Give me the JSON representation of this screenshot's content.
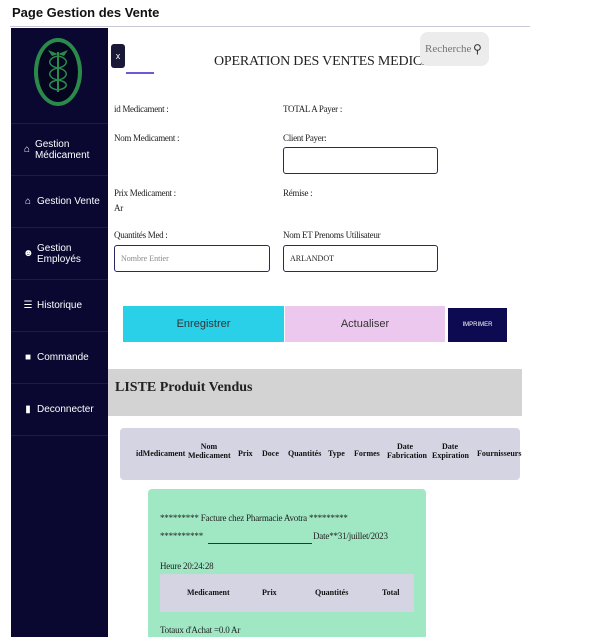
{
  "page_title": "Page Gestion des Vente",
  "sidebar": {
    "logo": "caduceus-logo",
    "items": [
      {
        "icon": "home-icon",
        "label": "Gestion Médicament"
      },
      {
        "icon": "home-icon",
        "label": "Gestion Vente"
      },
      {
        "icon": "user-plus-icon",
        "label": "Gestion Employés"
      },
      {
        "icon": "history-icon",
        "label": "Historique"
      },
      {
        "icon": "order-icon",
        "label": "Commande"
      },
      {
        "icon": "logout-icon",
        "label": "Deconnecter"
      }
    ]
  },
  "header": {
    "close_label": "x",
    "title": "OPERATION DES VENTES MEDICAMENT",
    "search_placeholder": "Rechercher M"
  },
  "form": {
    "id_label": "id Medicament :",
    "total_label": "TOTAL A Payer :",
    "name_label": "Nom Medicament :",
    "client_pay_label": "Client Payer:",
    "client_pay_value": "",
    "price_label": "Prix Medicament :",
    "price_value": "Ar",
    "remise_label": "Rémise :",
    "qty_label": "Quantités Med :",
    "qty_placeholder": "Nombre Entier",
    "user_label": "Nom ET Prenoms Utilisateur",
    "user_value": "ARLANDOT"
  },
  "buttons": {
    "save": "Enregistrer",
    "refresh": "Actualiser",
    "print": "IMPRIMER"
  },
  "list": {
    "title": "LISTE Produit Vendus",
    "columns": [
      "idMedicament",
      "Nom Medicament",
      "Prix",
      "Doce",
      "Quantités",
      "Type",
      "Formes",
      "Date Fabrication",
      "Date Expiration",
      "Fournisseurs"
    ]
  },
  "invoice": {
    "line1": "********* Facture chez Pharmacie Avotra *********",
    "line2_stars": "**********",
    "line2_date": "Date**31/juillet/2023",
    "time": "Heure 20:24:28",
    "columns": [
      "Medicament",
      "Prix",
      "Quantités",
      "Total"
    ],
    "total_line": "Totaux d'Achat =0.0 Ar"
  },
  "colors": {
    "sidebar": "#0a0830",
    "save_button": "#2ad0e8",
    "refresh_button": "#ecc7ee",
    "print_button": "#0e0a52",
    "invoice_bg": "#a0e8c4"
  }
}
